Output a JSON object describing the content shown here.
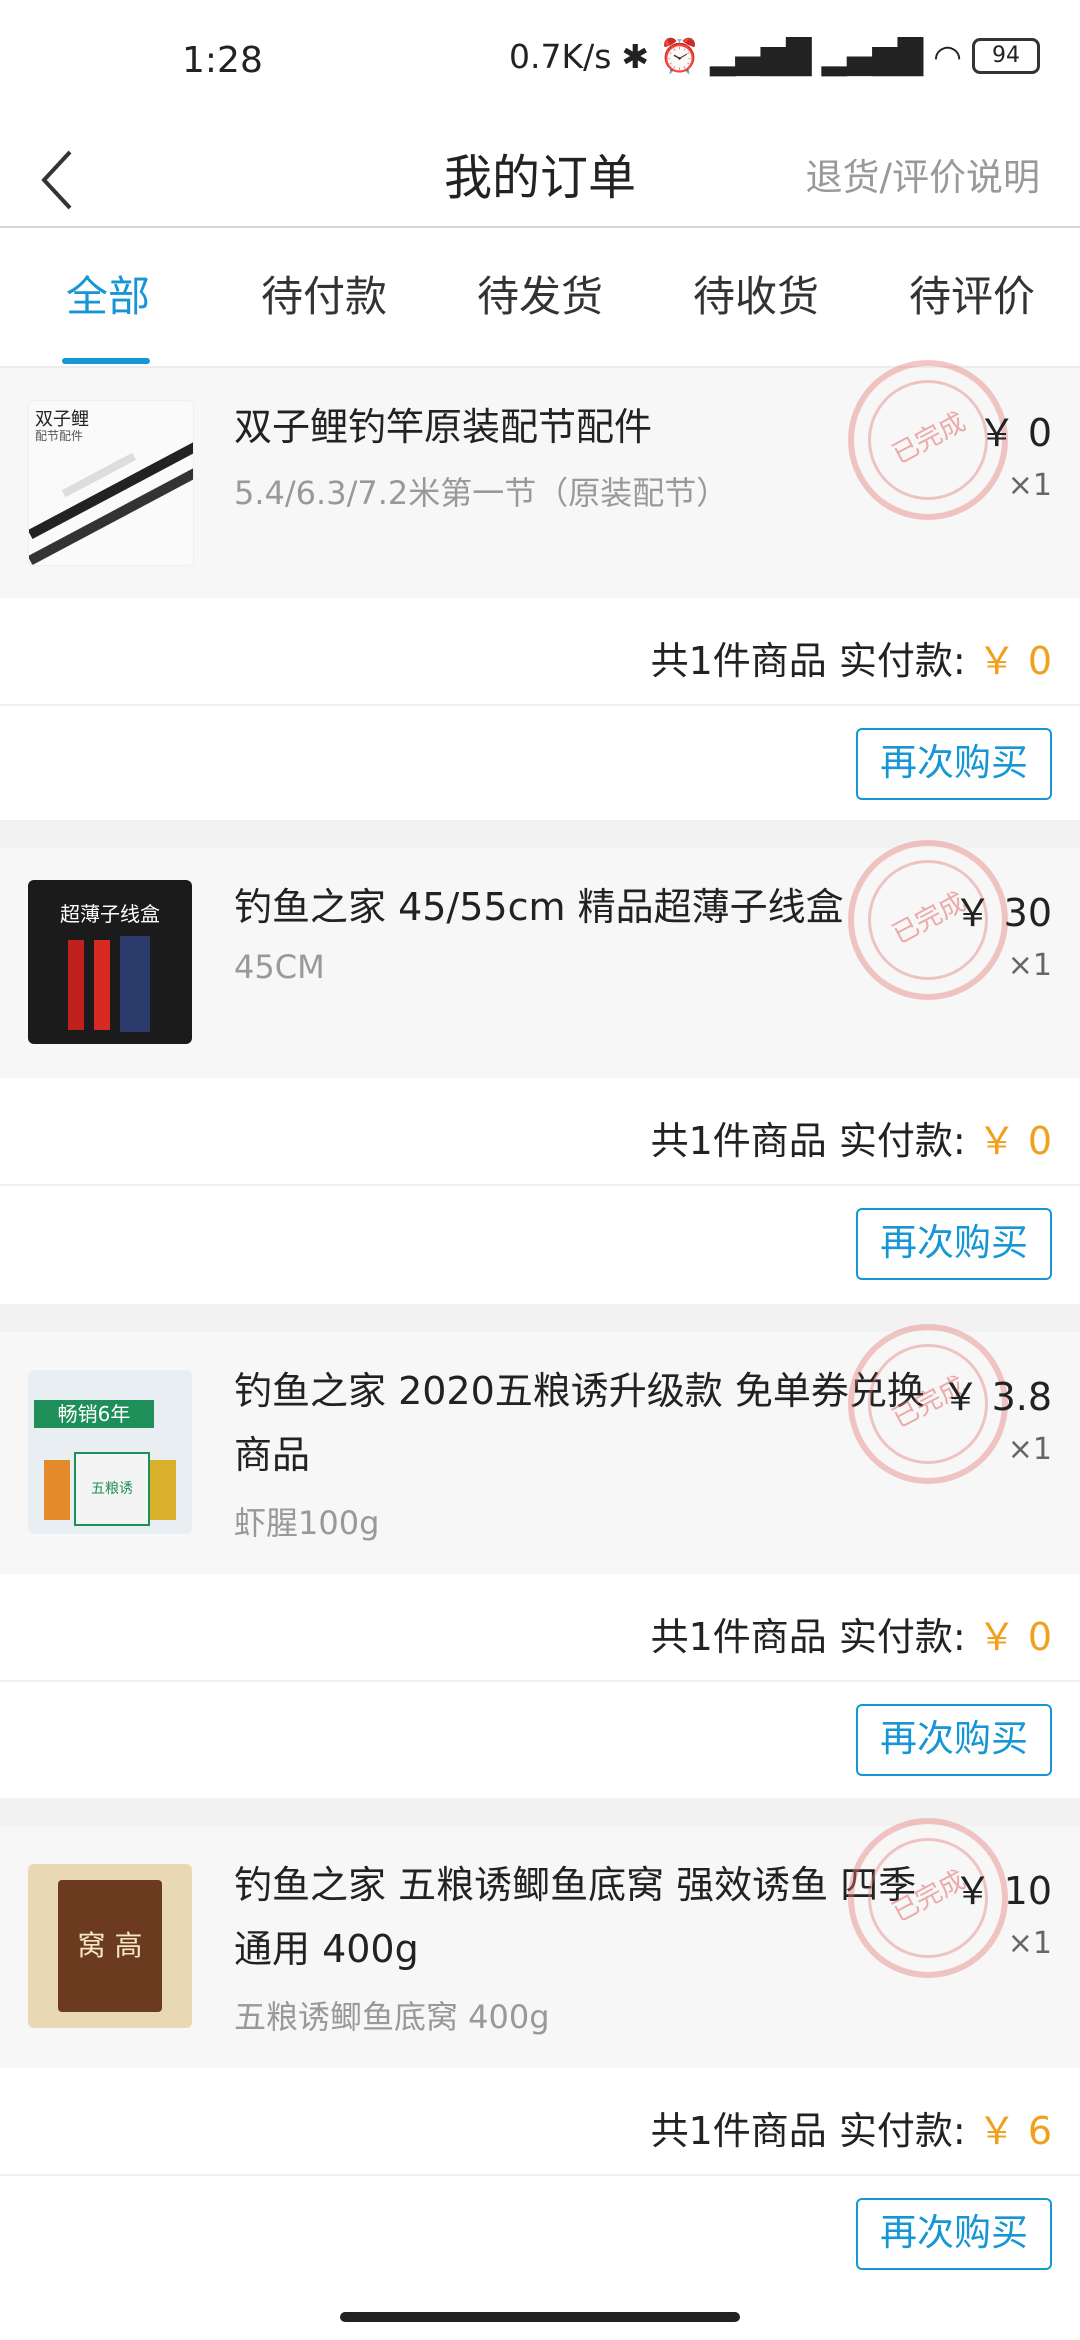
{
  "status": {
    "time": "1:28",
    "speed": "0.7K/s",
    "battery": "94"
  },
  "header": {
    "title": "我的订单",
    "return_link": "退货/评价说明"
  },
  "tabs": [
    {
      "label": "全部"
    },
    {
      "label": "待付款"
    },
    {
      "label": "待发货"
    },
    {
      "label": "待收货"
    },
    {
      "label": "待评价"
    }
  ],
  "colors": {
    "accent": "#1696d2",
    "price": "#f0a01e",
    "stamp": "#e67878"
  },
  "orders": [
    {
      "title_line1": "双子鲤钓竿原装配节配件",
      "title_line2": "",
      "spec": "5.4/6.3/7.2米第一节（原装配节）",
      "price": "￥ 0",
      "qty": "×1",
      "status": "已完成",
      "summary_label": "共1件商品  实付款: ",
      "paid": "￥ 0",
      "button": "再次购买",
      "thumb_label": "双子鲤",
      "thumb_sub": "配节配件"
    },
    {
      "title_line1": "钓鱼之家 45/55cm 精品超薄子线盒",
      "title_line2": "",
      "spec": "45CM",
      "price": "￥ 30",
      "qty": "×1",
      "status": "已完成",
      "summary_label": "共1件商品  实付款: ",
      "paid": "￥ 0",
      "button": "再次购买",
      "thumb_label": "超薄子线盒"
    },
    {
      "title_line1": "钓鱼之家 2020五粮诱升级款 免单券兑换",
      "title_line2": "商品",
      "spec": "虾腥100g",
      "price": "￥ 3.8",
      "qty": "×1",
      "status": "已完成",
      "summary_label": "共1件商品  实付款: ",
      "paid": "￥ 0",
      "button": "再次购买",
      "thumb_label": "畅销6年",
      "thumb_sub": "五粮诱"
    },
    {
      "title_line1": "钓鱼之家 五粮诱鲫鱼底窝  强效诱鱼 四季",
      "title_line2": "通用 400g",
      "spec": "五粮诱鲫鱼底窝 400g",
      "price": "￥ 10",
      "qty": "×1",
      "status": "已完成",
      "summary_label": "共1件商品  实付款: ",
      "paid": "￥ 6",
      "button": "再次购买",
      "thumb_label": "窝 高"
    }
  ]
}
